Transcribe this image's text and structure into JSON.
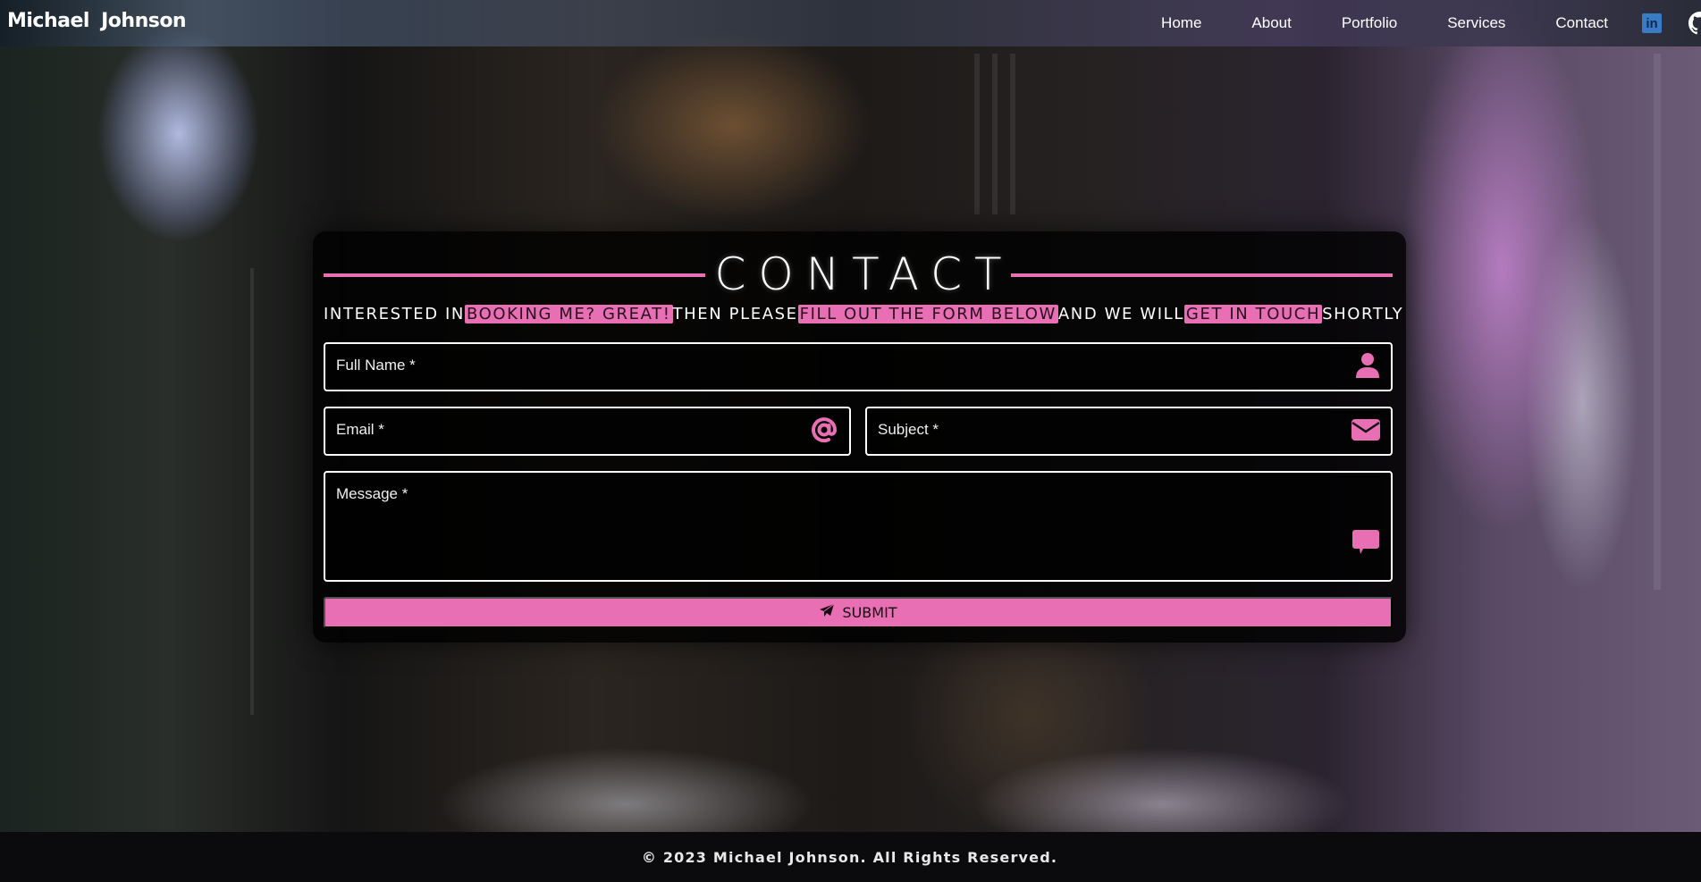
{
  "nav": {
    "brand": "Michael  Johnson",
    "links": [
      {
        "label": "Home"
      },
      {
        "label": "About"
      },
      {
        "label": "Portfolio"
      },
      {
        "label": "Services"
      },
      {
        "label": "Contact"
      }
    ],
    "social": [
      {
        "icon": "linkedin-icon",
        "glyph": "in"
      },
      {
        "icon": "github-icon"
      }
    ]
  },
  "contact": {
    "heading": "CONTACT",
    "subtitle": {
      "part1": "INTERESTED IN",
      "hl1": "BOOKING ME? GREAT!",
      "part2": "THEN PLEASE",
      "hl2": "FILL OUT THE FORM BELOW",
      "part3": "AND WE WILL",
      "hl3": "GET IN TOUCH",
      "part4": "SHORTLY"
    },
    "fields": {
      "full_name": {
        "label": "Full Name *",
        "value": "",
        "icon": "user-icon"
      },
      "email": {
        "label": "Email *",
        "value": "",
        "icon": "at-icon"
      },
      "subject": {
        "label": "Subject *",
        "value": "",
        "icon": "envelope-icon"
      },
      "message": {
        "label": "Message *",
        "value": "",
        "icon": "comment-icon"
      }
    },
    "submit_label": "SUBMIT",
    "submit_icon": "paper-plane-icon"
  },
  "colors": {
    "accent": "#e96fb5",
    "footer_bg": "#0b0b0d",
    "linkedin": "#3a7bc8"
  },
  "footer": {
    "text": "© 2023 Michael Johnson. All Rights Reserved."
  }
}
